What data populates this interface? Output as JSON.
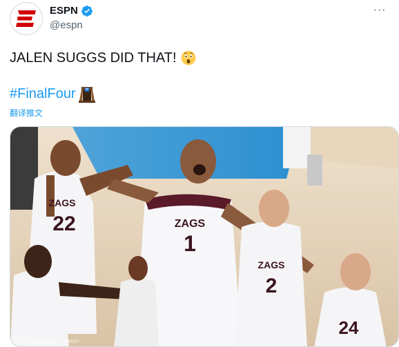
{
  "tweet": {
    "author": {
      "display_name": "ESPN",
      "handle": "@espn",
      "verified": true,
      "avatar_icon": "espn-logo-icon",
      "avatar_color": "#d10000"
    },
    "more_icon": "more-icon",
    "text": "JALEN SUGGS DID THAT!",
    "emoji": "astonished-face-emoji",
    "hashtag": "#FinalFour",
    "hashtag_emoji": "ncaa-final-four-emoji",
    "translate_label": "翻译推文",
    "media": {
      "alt": "Gonzaga players celebrating on court",
      "jerseys": [
        "22",
        "1",
        "2",
        "24"
      ],
      "team_word": "ZAGS",
      "credit": "AP PHOTO/MICHAEL CONROY"
    },
    "colors": {
      "link": "#1d9bf0",
      "text": "#0f1419",
      "secondary": "#536471"
    }
  }
}
